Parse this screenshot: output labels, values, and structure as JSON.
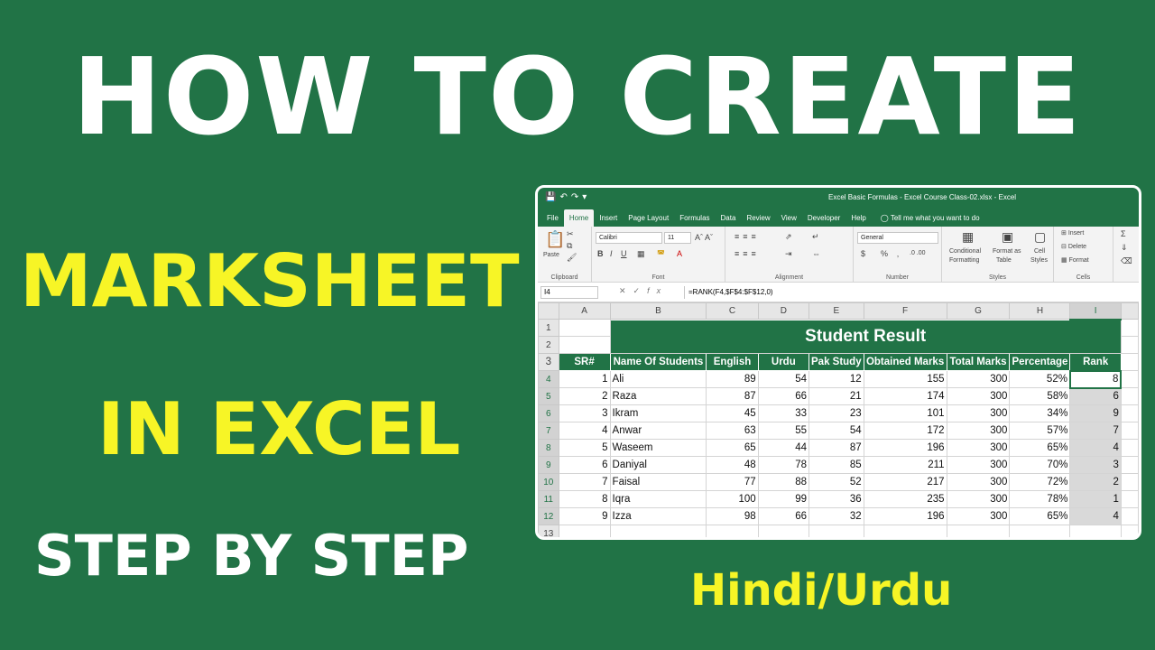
{
  "headline": {
    "line1": "HOW TO CREATE",
    "line2": "MARKSHEET",
    "line3": "IN EXCEL",
    "line4": "STEP BY STEP",
    "language": "Hindi/Urdu"
  },
  "excel": {
    "window_title": "Excel Basic Formulas - Excel Course Class-02.xlsx  -  Excel",
    "tabs": [
      "File",
      "Home",
      "Insert",
      "Page Layout",
      "Formulas",
      "Data",
      "Review",
      "View",
      "Developer",
      "Help"
    ],
    "active_tab": "Home",
    "tell_me": "Tell me what you want to do",
    "ribbon": {
      "clipboard": {
        "paste": "Paste",
        "label": "Clipboard"
      },
      "font": {
        "name": "Calibri",
        "size": "11",
        "label": "Font"
      },
      "alignment": {
        "label": "Alignment"
      },
      "number": {
        "format": "General",
        "label": "Number"
      },
      "styles": {
        "conditional": "Conditional",
        "formatting": "Formatting",
        "format_as": "Format as",
        "table": "Table",
        "cell": "Cell",
        "cell_styles": "Styles",
        "label": "Styles"
      },
      "cells": {
        "insert": "Insert",
        "delete": "Delete",
        "format": "Format",
        "label": "Cells"
      }
    },
    "name_box": "I4",
    "formula": "=RANK(F4,$F$4:$F$12,0)",
    "columns": [
      "A",
      "B",
      "C",
      "D",
      "E",
      "F",
      "G",
      "H",
      "I"
    ],
    "rows": [
      "1",
      "2",
      "3",
      "4",
      "5",
      "6",
      "7",
      "8",
      "9",
      "10",
      "11",
      "12",
      "13"
    ],
    "sheet_title": "Student Result",
    "headers": [
      "SR#",
      "Name Of Students",
      "English",
      "Urdu",
      "Pak Study",
      "Obtained Marks",
      "Total Marks",
      "Percentage",
      "Rank"
    ],
    "data": [
      [
        "1",
        "Ali",
        "89",
        "54",
        "12",
        "155",
        "300",
        "52%",
        "8"
      ],
      [
        "2",
        "Raza",
        "87",
        "66",
        "21",
        "174",
        "300",
        "58%",
        "6"
      ],
      [
        "3",
        "Ikram",
        "45",
        "33",
        "23",
        "101",
        "300",
        "34%",
        "9"
      ],
      [
        "4",
        "Anwar",
        "63",
        "55",
        "54",
        "172",
        "300",
        "57%",
        "7"
      ],
      [
        "5",
        "Waseem",
        "65",
        "44",
        "87",
        "196",
        "300",
        "65%",
        "4"
      ],
      [
        "6",
        "Daniyal",
        "48",
        "78",
        "85",
        "211",
        "300",
        "70%",
        "3"
      ],
      [
        "7",
        "Faisal",
        "77",
        "88",
        "52",
        "217",
        "300",
        "72%",
        "2"
      ],
      [
        "8",
        "Iqra",
        "100",
        "99",
        "36",
        "235",
        "300",
        "78%",
        "1"
      ],
      [
        "9",
        "Izza",
        "98",
        "66",
        "32",
        "196",
        "300",
        "65%",
        "4"
      ]
    ]
  }
}
